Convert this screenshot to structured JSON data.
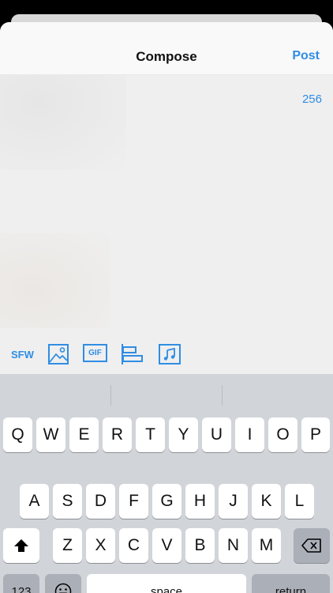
{
  "nav": {
    "title": "Compose",
    "post_label": "Post"
  },
  "compose": {
    "char_count": "256"
  },
  "toolbar": {
    "sfw_label": "SFW",
    "gif_label": "GIF",
    "icons": [
      "image-icon",
      "gif-icon",
      "poll-icon",
      "music-icon"
    ]
  },
  "keyboard": {
    "row1": [
      "Q",
      "W",
      "E",
      "R",
      "T",
      "Y",
      "U",
      "I",
      "O",
      "P"
    ],
    "row2": [
      "A",
      "S",
      "D",
      "F",
      "G",
      "H",
      "J",
      "K",
      "L"
    ],
    "row3": [
      "Z",
      "X",
      "C",
      "V",
      "B",
      "N",
      "M"
    ],
    "numbers_label": "123",
    "space_label": "space",
    "return_label": "return",
    "shift_icon": "shift-icon",
    "backspace_icon": "backspace-icon",
    "emoji_icon": "emoji-icon"
  },
  "colors": {
    "accent": "#2f8de4",
    "keyboard_bg": "#d1d4d9",
    "key_bg": "#ffffff",
    "key_dark": "#abafb8"
  }
}
